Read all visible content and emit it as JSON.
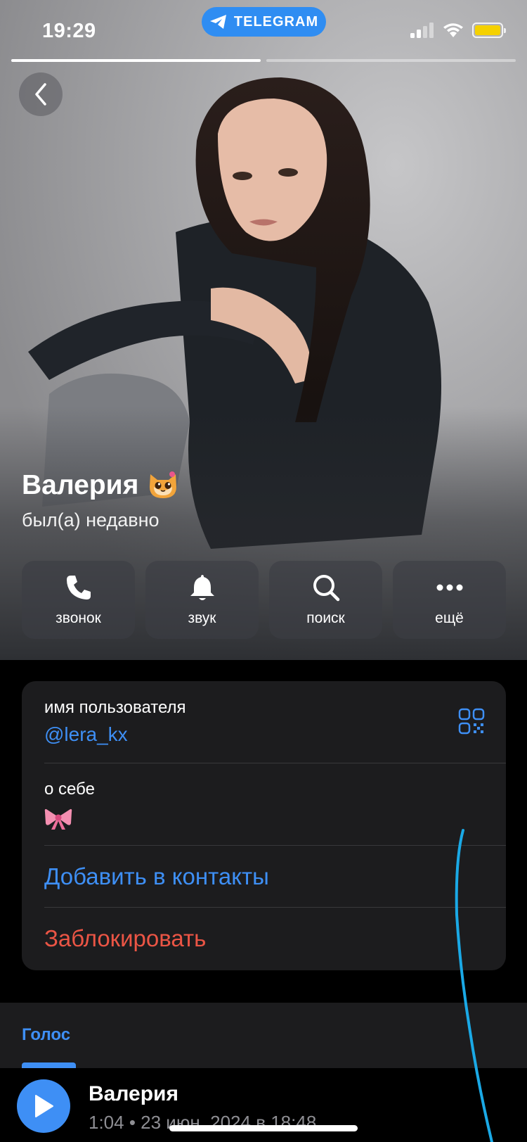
{
  "status_bar": {
    "time": "19:29",
    "app_pill": "TELEGRAM"
  },
  "story_progress": {
    "segments": 2,
    "active_index": 0
  },
  "profile": {
    "name": "Валерия",
    "name_emoji": "🐱",
    "last_seen": "был(а) недавно"
  },
  "actions": [
    {
      "label": "звонок",
      "icon": "phone-icon"
    },
    {
      "label": "звук",
      "icon": "bell-icon"
    },
    {
      "label": "поиск",
      "icon": "search-icon"
    },
    {
      "label": "ещё",
      "icon": "more-icon"
    }
  ],
  "info": {
    "username_label": "имя пользователя",
    "username_value": "@lera_kx",
    "bio_label": "о себе",
    "bio_value": "🎀",
    "add_contact": "Добавить в контакты",
    "block": "Заблокировать"
  },
  "tabs": {
    "voice": "Голос"
  },
  "player": {
    "name": "Валерия",
    "meta": "1:04 • 23 июн. 2024 в 18:48"
  },
  "colors": {
    "accent": "#3e8ff5",
    "danger": "#eb5545",
    "card": "#1c1c1e",
    "telegram_pill": "#2f8df2",
    "battery": "#f5d100",
    "pen": "#1aa9e6"
  }
}
